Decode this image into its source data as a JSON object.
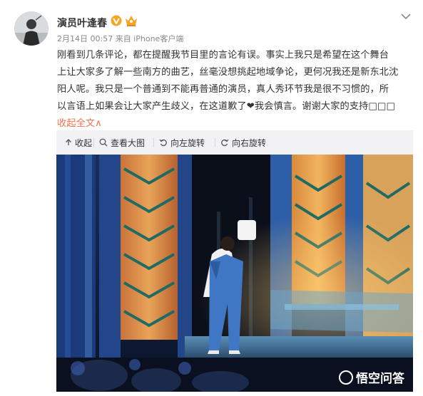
{
  "author": {
    "name": "演员叶逢春",
    "meta": "2月14日 00:57 来自 iPhone客户端"
  },
  "post": {
    "lines": [
      "刚看到几条评论，都在提醒我节目里的言论有误。事实上我只是希望在这个舞台",
      "上让大家多了解一些南方的曲艺，丝毫没想挑起地域争论，更何况我还是新东北沈",
      "阳人呢。我只是一个普通到不能再普通的演员，真人秀环节我是很不习惯的，所",
      "以言语上如果会让大家产生歧义，在这道歉了❤我会慎言。谢谢大家的支持□□□"
    ],
    "collapse_label": "收起全文",
    "collapse_arrow": "∧"
  },
  "toolbar": {
    "collapse": "收起",
    "view_large": "查看大图",
    "rotate_left": "向左旋转",
    "rotate_right": "向右旋转"
  },
  "photo": {
    "watermark": "悟空问答"
  },
  "colors": {
    "link": "#eb7350",
    "verified": "#f5a623",
    "toolbar_bg": "#f2f2f5"
  }
}
